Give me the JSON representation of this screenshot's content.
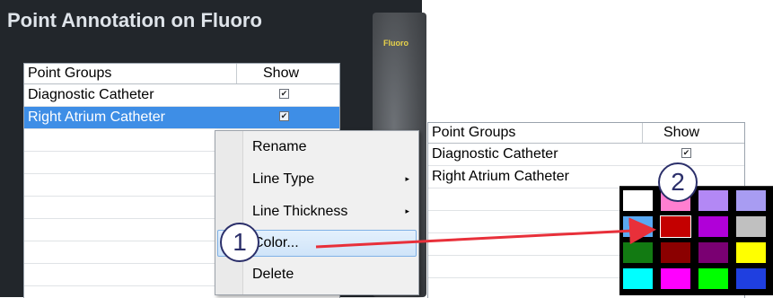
{
  "app": {
    "title": "Point Annotation on Fluoro",
    "fluoro_label": "Fluoro"
  },
  "left_table": {
    "headers": {
      "name": "Point Groups",
      "show": "Show"
    },
    "rows": [
      {
        "name": "Diagnostic Catheter",
        "checked": "✔"
      },
      {
        "name": "Right Atrium Catheter",
        "checked": "✔"
      }
    ]
  },
  "context_menu": {
    "items": [
      {
        "label": "Rename",
        "arrow": ""
      },
      {
        "label": "Line Type",
        "arrow": "▸"
      },
      {
        "label": "Line Thickness",
        "arrow": "▸"
      },
      {
        "label": "Color...",
        "arrow": ""
      },
      {
        "label": "Delete",
        "arrow": ""
      }
    ]
  },
  "callouts": {
    "one": "1",
    "two": "2"
  },
  "right_table": {
    "headers": {
      "name": "Point Groups",
      "show": "Show"
    },
    "rows": [
      {
        "name": "Diagnostic Catheter",
        "checked": "✔"
      },
      {
        "name": "Right Atrium Catheter",
        "checked": ""
      }
    ]
  },
  "palette": {
    "colors": [
      "#ffffff",
      "#ff7fd0",
      "#b388f5",
      "#a89cf2",
      "#5aa9f2",
      "#c40000",
      "#b000d8",
      "#c0c0c0",
      "#127a12",
      "#8b0000",
      "#7a0072",
      "#ffff00",
      "#00ffff",
      "#ff00ff",
      "#00ff00",
      "#1f3fe0"
    ],
    "selected_index": 5
  },
  "colors": {
    "accent": "#3e8ee6",
    "arrow": "#e8303a",
    "callout": "#2b2f6a"
  }
}
